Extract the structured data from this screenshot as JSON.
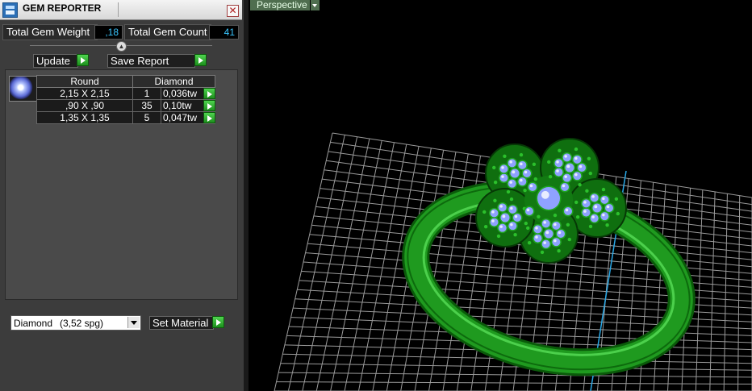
{
  "window": {
    "title": "GEM REPORTER",
    "close_symbol": "✕"
  },
  "stats": {
    "total_weight_label": "Total Gem Weight",
    "total_weight_value": ",18",
    "total_count_label": "Total Gem Count",
    "total_count_value": "41"
  },
  "toolbar": {
    "update_label": "Update",
    "save_report_label": "Save Report"
  },
  "table": {
    "headers": [
      "Round",
      "Diamond"
    ],
    "rows": [
      {
        "size": "2,15 X 2,15",
        "count": "1",
        "weight": "0,036tw"
      },
      {
        "size": ",90 X ,90",
        "count": "35",
        "weight": "0,10tw"
      },
      {
        "size": "1,35 X 1,35",
        "count": "5",
        "weight": "0,047tw"
      }
    ]
  },
  "material": {
    "name": "Diamond",
    "spec": "(3,52 spg)",
    "set_label": "Set Material"
  },
  "viewport": {
    "view_label": "Perspective"
  },
  "colors": {
    "accent_value": "#39c6ff",
    "go_button": "#2fb52f",
    "ring": "#1a8a1a",
    "gem": "#9fb0ff",
    "grid": "#9a9a9a"
  },
  "icons": [
    "app-icon",
    "close-icon",
    "collapse-icon",
    "go-arrow-icon",
    "gem-thumbnail",
    "dropdown-arrow-icon"
  ]
}
